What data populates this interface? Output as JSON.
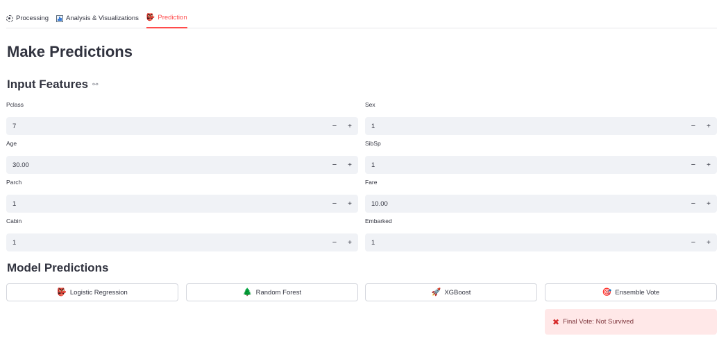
{
  "tabs": [
    {
      "label": "Processing",
      "icon": "gear-icon",
      "active": false
    },
    {
      "label": "Analysis & Visualizations",
      "icon": "bar-chart-icon",
      "active": false
    },
    {
      "label": "Prediction",
      "icon": "mask-icon",
      "active": true
    }
  ],
  "page_title": "Make Predictions",
  "input_section": {
    "heading": "Input Features",
    "fields": [
      {
        "label": "Pclass",
        "value": "7"
      },
      {
        "label": "Sex",
        "value": "1"
      },
      {
        "label": "Age",
        "value": "30.00"
      },
      {
        "label": "SibSp",
        "value": "1"
      },
      {
        "label": "Parch",
        "value": "1"
      },
      {
        "label": "Fare",
        "value": "10.00"
      },
      {
        "label": "Cabin",
        "value": "1"
      },
      {
        "label": "Embarked",
        "value": "1"
      }
    ],
    "minus_glyph": "−",
    "plus_glyph": "+"
  },
  "model_section": {
    "heading": "Model Predictions",
    "buttons": [
      {
        "label": "Logistic Regression",
        "icon": "mask-icon",
        "glyph": "👺"
      },
      {
        "label": "Random Forest",
        "icon": "tree-icon",
        "glyph": "🌲"
      },
      {
        "label": "XGBoost",
        "icon": "rocket-icon",
        "glyph": "🚀"
      },
      {
        "label": "Ensemble Vote",
        "icon": "target-icon",
        "glyph": "🎯"
      }
    ]
  },
  "result": {
    "text": "Final Vote: Not Survived",
    "icon": "x-icon",
    "glyph": "✖"
  },
  "colors": {
    "accent": "#ff4b4b",
    "input_bg": "#f0f2f6",
    "error_bg": "#ffe8e8",
    "error_text": "#7d353b"
  }
}
